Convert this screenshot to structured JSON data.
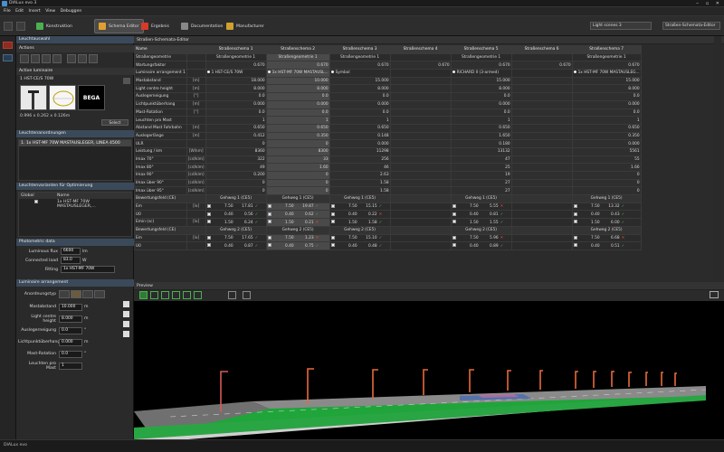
{
  "app": {
    "title": "DIALux evo 3",
    "status": "DIALux evo"
  },
  "menu": [
    "File",
    "Edit",
    "Insert",
    "View",
    "Debuggen"
  ],
  "toolbar": {
    "tabs": [
      {
        "label": "Konstruktion",
        "color": "#4caf50"
      },
      {
        "label": "Schema Editor",
        "color": "#e0a030",
        "active": true
      },
      {
        "label": "Ergebnis",
        "color": "#d83a2a"
      },
      {
        "label": "Documentation",
        "color": "#888888"
      },
      {
        "label": "Manufacturer",
        "color": "#d0a030"
      }
    ],
    "light_scenes": "Light scenes 3",
    "view_select": "Straßen-Schemata-Editor"
  },
  "left": {
    "sel_head": "Leuchtauswahl",
    "actions_head": "Actions",
    "active_head": "Active luminaire",
    "active_name": "1 HST-CE/S 70W",
    "dimensions": "0.996 x 0.262 x 0.126m",
    "select_btn": "Select",
    "brand": "BEGA",
    "arr_head": "Leuchtenanordnungen",
    "arr_item": "1. 1x HST-MF 70W MASTAUSLEGER, LINEA 4500",
    "opt_head": "Leuchtenvarianten für Optimierung",
    "opt_cols": [
      "Global",
      "Name"
    ],
    "opt_row": "1x HST-MF 70W MASTAUSLEGER,...",
    "photo_head": "Photometric data",
    "photo": [
      {
        "label": "Luminous flux",
        "value": "6600",
        "unit": "lm"
      },
      {
        "label": "Connected load",
        "value": "83.0",
        "unit": "W"
      },
      {
        "label": "Fitting",
        "value": "1x HST-MF 70W"
      }
    ],
    "lumarr_head": "Luminaire arrangement",
    "lumarr_type": "Anordnungstyp",
    "lumarr": [
      {
        "label": "Mastabstand",
        "value": "10.000",
        "unit": "m"
      },
      {
        "label": "Light centre height",
        "value": "8.000",
        "unit": "m"
      },
      {
        "label": "Auslegerneigung",
        "value": "0.0",
        "unit": "°"
      },
      {
        "label": "Lichtpunktüberhang",
        "value": "0.000",
        "unit": "m"
      },
      {
        "label": "Mast-Rotation",
        "value": "0.0",
        "unit": "°"
      },
      {
        "label": "Leuchten pro Mast",
        "value": "1",
        "unit": ""
      }
    ]
  },
  "editor": {
    "header": "Straßen-Schemata-Editor",
    "columns": [
      "Straßenschema 1",
      "Straßenschema 2",
      "Straßenschema 3",
      "Straßenschema 4",
      "Straßenschema 5",
      "Straßenschema 6",
      "Straßenschema 7"
    ],
    "rows": [
      {
        "label": "Straßengeometrie",
        "unit": "",
        "cells": [
          "Straßengeometrie 1",
          "Straßengeometrie 1",
          "Straßengeometrie 1",
          "",
          "Straßengeometrie 1",
          "",
          "Straßengeometrie 1"
        ]
      },
      {
        "label": "Wartungsfaktor",
        "unit": "",
        "cells": [
          "0.670",
          "0.670",
          "0.670",
          "0.670",
          "0.670",
          "0.670",
          "0.670"
        ]
      },
      {
        "label": "Luminaire arrangement 1",
        "unit": "",
        "cells": [
          "1 HST-CE/S 70W",
          "1x HST-MF 70W MASTAUSL...",
          "Symbol",
          "",
          "RICHARD II (3-armed)",
          "",
          "1x HST-MF 70W MASTAUSLEG..."
        ]
      },
      {
        "label": "Mastabstand",
        "unit": "[m]",
        "cells": [
          "18.000",
          "10.000",
          "15.000",
          "",
          "15.000",
          "",
          "15.000"
        ]
      },
      {
        "label": "Light centre height",
        "unit": "[m]",
        "cells": [
          "8.000",
          "8.000",
          "8.000",
          "",
          "8.000",
          "",
          "8.000"
        ]
      },
      {
        "label": "Auslegerneigung",
        "unit": "[°]",
        "cells": [
          "0.0",
          "0.0",
          "0.0",
          "",
          "0.0",
          "",
          "0.0"
        ]
      },
      {
        "label": "Lichtpunktüberhang",
        "unit": "[m]",
        "cells": [
          "0.000",
          "0.000",
          "0.000",
          "",
          "0.000",
          "",
          "0.000"
        ]
      },
      {
        "label": "Mast-Rotation",
        "unit": "[°]",
        "cells": [
          "0.0",
          "0.0",
          "0.0",
          "",
          "0.0",
          "",
          "0.0"
        ]
      },
      {
        "label": "Leuchten pro Mast",
        "unit": "",
        "cells": [
          "1",
          "1",
          "1",
          "",
          "1",
          "",
          "1"
        ]
      },
      {
        "label": "Abstand Mast Fahrbahn",
        "unit": "[m]",
        "cells": [
          "0.650",
          "0.650",
          "0.650",
          "",
          "0.650",
          "",
          "0.650"
        ]
      },
      {
        "label": "Auslegerlänge",
        "unit": "[m]",
        "cells": [
          "0.412",
          "0.350",
          "0.148",
          "",
          "1.650",
          "",
          "0.350"
        ]
      },
      {
        "label": "ULR",
        "unit": "",
        "cells": [
          "0",
          "0",
          "0.000",
          "",
          "0.180",
          "",
          "0.000"
        ]
      },
      {
        "label": "Leistung / km",
        "unit": "[W/km]",
        "cells": [
          "8360",
          "8300",
          "11298",
          "",
          "13132",
          "",
          "5561"
        ]
      },
      {
        "label": "Imax 70°",
        "unit": "[cd/klm]",
        "cells": [
          "322",
          "33",
          "256",
          "",
          "47",
          "",
          "55"
        ]
      },
      {
        "label": "Imax 80°",
        "unit": "[cd/klm]",
        "cells": [
          "49",
          "1.60",
          "46",
          "",
          "25",
          "",
          "1.66"
        ]
      },
      {
        "label": "Imax 90°",
        "unit": "[cd/klm]",
        "cells": [
          "0.200",
          "0",
          "2.63",
          "",
          "19",
          "",
          "0"
        ]
      },
      {
        "label": "Imax über 90°",
        "unit": "[cd/klm]",
        "cells": [
          "0",
          "0",
          "1.58",
          "",
          "27",
          "",
          "0"
        ]
      },
      {
        "label": "Imax über 95°",
        "unit": "[cd/klm]",
        "cells": [
          "0",
          "0",
          "1.58",
          "",
          "27",
          "",
          "0"
        ]
      }
    ],
    "eval1": {
      "label": "Bewertungsfeld (CE)",
      "cell": "Gehweg 1 (CE5)"
    },
    "ev_rows": [
      {
        "label": "Em",
        "unit": "[lx]",
        "cells": [
          [
            "7.50",
            "17.81"
          ],
          [
            "7.50",
            "19.87"
          ],
          [
            "7.50",
            "15.15"
          ],
          [
            "",
            ""
          ],
          [
            "7.50",
            "5.55"
          ],
          [
            "",
            ""
          ],
          [
            "7.50",
            "13.32"
          ]
        ]
      },
      {
        "label": "U0",
        "unit": "",
        "cells": [
          [
            "0.40",
            "0.56"
          ],
          [
            "0.40",
            "0.62"
          ],
          [
            "0.40",
            "0.22"
          ],
          [
            "",
            ""
          ],
          [
            "0.40",
            "0.81"
          ],
          [
            "",
            ""
          ],
          [
            "0.40",
            "0.43"
          ]
        ]
      },
      {
        "label": "Emin (sc)",
        "unit": "[lx]",
        "cells": [
          [
            "1.50",
            "6.24"
          ],
          [
            "1.50",
            "0.21"
          ],
          [
            "1.50",
            "1.58"
          ],
          [
            "",
            ""
          ],
          [
            "1.50",
            "1.55"
          ],
          [
            "",
            ""
          ],
          [
            "1.50",
            "6.00"
          ]
        ]
      }
    ],
    "eval2": {
      "label": "Bewertungsfeld (CE)",
      "cell": "Gehweg 2 (CE5)"
    },
    "ev2_rows": [
      {
        "label": "Em",
        "unit": "[lx]",
        "cells": [
          [
            "7.50",
            "17.65"
          ],
          [
            "7.50",
            "1.23"
          ],
          [
            "7.50",
            "15.10"
          ],
          [
            "",
            ""
          ],
          [
            "7.50",
            "5.96"
          ],
          [
            "",
            ""
          ],
          [
            "7.50",
            "6.68"
          ]
        ]
      },
      {
        "label": "U0",
        "unit": "",
        "cells": [
          [
            "0.40",
            "0.87"
          ],
          [
            "0.40",
            "0.75"
          ],
          [
            "0.40",
            "0.48"
          ],
          [
            "",
            ""
          ],
          [
            "0.40",
            "0.89"
          ],
          [
            "",
            ""
          ],
          [
            "0.40",
            "0.51"
          ]
        ]
      }
    ],
    "name_label": "Name"
  },
  "preview": {
    "label": "Preview"
  }
}
